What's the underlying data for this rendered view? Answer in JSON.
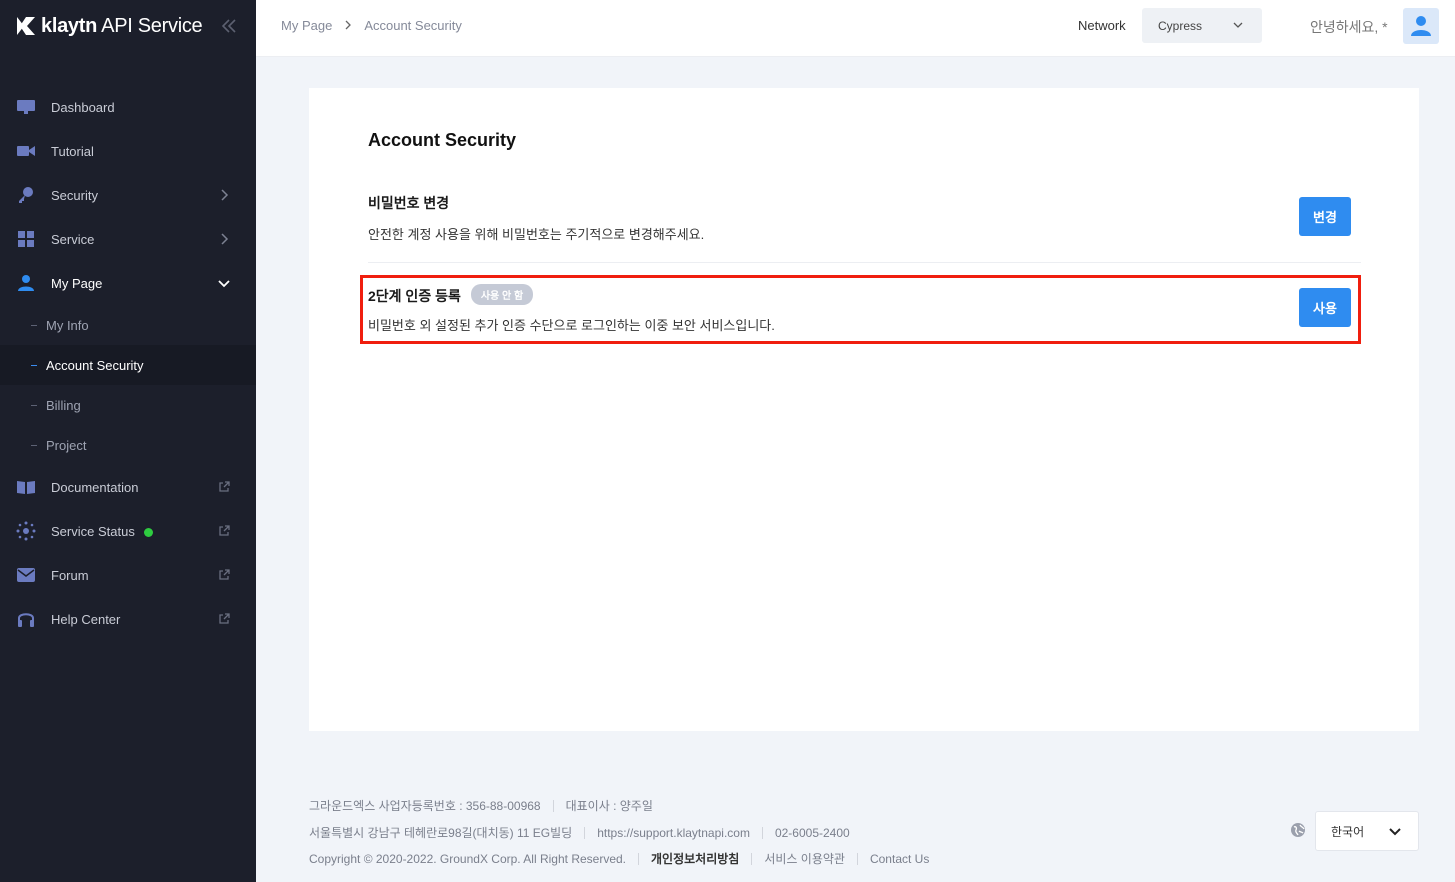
{
  "app": {
    "logo_text": "klaytn",
    "logo_suffix": "API Service"
  },
  "sidebar": {
    "items": [
      {
        "label": "Dashboard",
        "icon": "monitor-icon"
      },
      {
        "label": "Tutorial",
        "icon": "video-camera-icon"
      },
      {
        "label": "Security",
        "icon": "key-icon"
      },
      {
        "label": "Service",
        "icon": "grid-icon"
      },
      {
        "label": "My Page",
        "icon": "user-icon"
      },
      {
        "label": "Documentation",
        "icon": "book-icon"
      },
      {
        "label": "Service Status",
        "icon": "status-icon"
      },
      {
        "label": "Forum",
        "icon": "mail-icon"
      },
      {
        "label": "Help Center",
        "icon": "headset-icon"
      }
    ],
    "sub_items": [
      {
        "label": "My Info"
      },
      {
        "label": "Account Security"
      },
      {
        "label": "Billing"
      },
      {
        "label": "Project"
      }
    ]
  },
  "header": {
    "breadcrumb": [
      "My Page",
      "Account Security"
    ],
    "network_label": "Network",
    "network_value": "Cypress",
    "greeting": "안녕하세요, *"
  },
  "main": {
    "title": "Account Security",
    "password": {
      "title": "비밀번호 변경",
      "desc": "안전한 계정 사용을 위해 비밀번호는 주기적으로 변경해주세요.",
      "button": "변경"
    },
    "two_factor": {
      "title": "2단계 인증 등록",
      "badge": "사용 안 함",
      "desc": "비밀번호 외 설정된 추가 인증 수단으로 로그인하는 이중 보안 서비스입니다.",
      "button": "사용"
    }
  },
  "footer": {
    "company": "그라운드엑스 사업자등록번호 : 356-88-00968",
    "ceo": "대표이사 : 양주일",
    "address": "서울특별시 강남구 테헤란로98길(대치동) 11 EG빌딩",
    "support_url": "https://support.klaytnapi.com",
    "phone": "02-6005-2400",
    "copyright": "Copyright © 2020-2022. GroundX Corp. All Right Reserved.",
    "privacy": "개인정보처리방침",
    "terms": "서비스 이용약관",
    "contact": "Contact Us",
    "language": "한국어"
  },
  "colors": {
    "accent": "#2f8cf0",
    "sidebar_bg": "#1c1f2b",
    "highlight": "#f01e0e",
    "status_ok": "#2ecc40"
  }
}
